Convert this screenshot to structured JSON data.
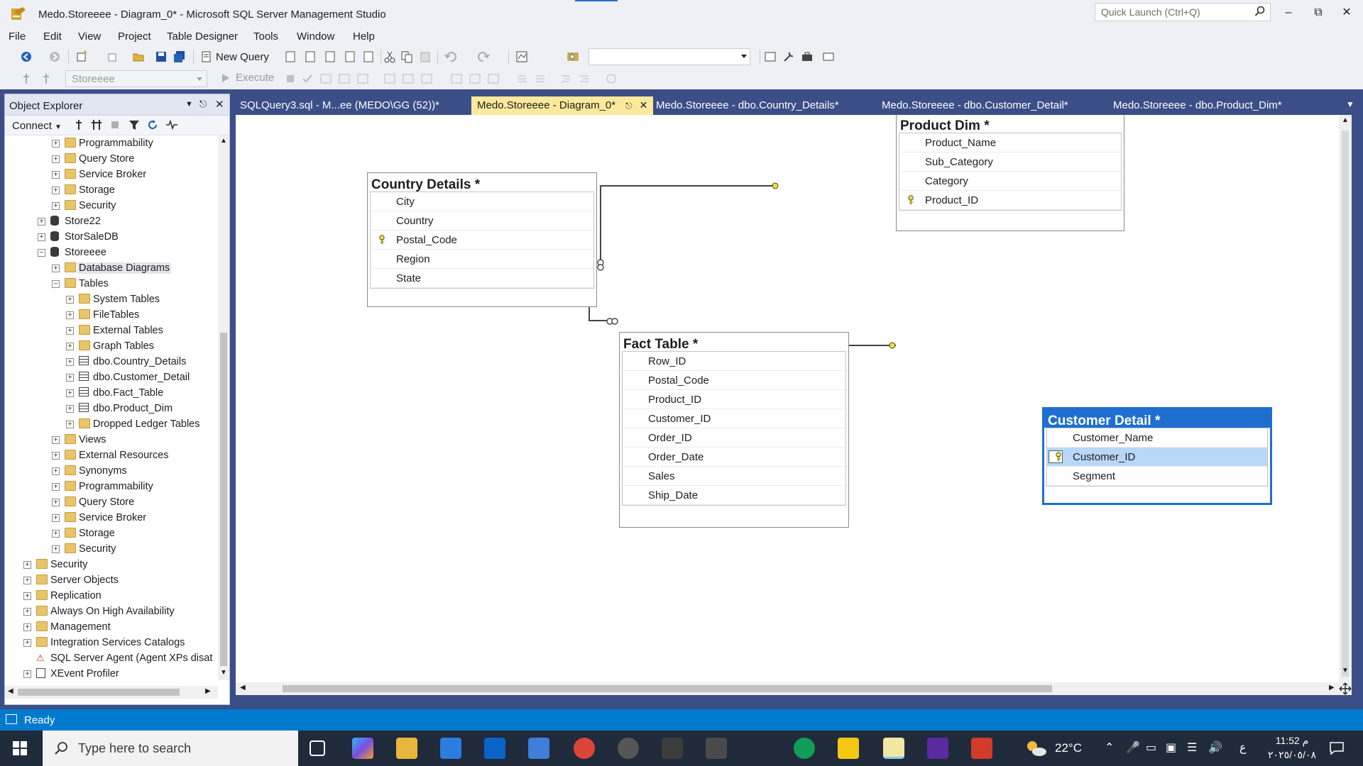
{
  "window": {
    "title": "Medo.Storeeee - Diagram_0* - Microsoft SQL Server Management Studio",
    "quick_launch_placeholder": "Quick Launch (Ctrl+Q)"
  },
  "menu": [
    "File",
    "Edit",
    "View",
    "Project",
    "Table Designer",
    "Tools",
    "Window",
    "Help"
  ],
  "toolbar": {
    "new_query": "New Query",
    "database_combo": "Storeeee",
    "execute": "Execute"
  },
  "object_explorer": {
    "title": "Object Explorer",
    "connect": "Connect",
    "tree": [
      {
        "label": "Programmability",
        "type": "folder",
        "level": 3,
        "expander": "+"
      },
      {
        "label": "Query Store",
        "type": "folder",
        "level": 3,
        "expander": "+"
      },
      {
        "label": "Service Broker",
        "type": "folder",
        "level": 3,
        "expander": "+"
      },
      {
        "label": "Storage",
        "type": "folder",
        "level": 3,
        "expander": "+"
      },
      {
        "label": "Security",
        "type": "folder",
        "level": 3,
        "expander": "+"
      },
      {
        "label": "Store22",
        "type": "db",
        "level": 2,
        "expander": "+"
      },
      {
        "label": "StorSaleDB",
        "type": "db",
        "level": 2,
        "expander": "+"
      },
      {
        "label": "Storeeee",
        "type": "db",
        "level": 2,
        "expander": "-"
      },
      {
        "label": "Database Diagrams",
        "type": "folder",
        "level": 3,
        "expander": "+",
        "selected": true
      },
      {
        "label": "Tables",
        "type": "folder",
        "level": 3,
        "expander": "-"
      },
      {
        "label": "System Tables",
        "type": "folder",
        "level": 4,
        "expander": "+"
      },
      {
        "label": "FileTables",
        "type": "folder",
        "level": 4,
        "expander": "+"
      },
      {
        "label": "External Tables",
        "type": "folder",
        "level": 4,
        "expander": "+"
      },
      {
        "label": "Graph Tables",
        "type": "folder",
        "level": 4,
        "expander": "+"
      },
      {
        "label": "dbo.Country_Details",
        "type": "table",
        "level": 4,
        "expander": "+"
      },
      {
        "label": "dbo.Customer_Detail",
        "type": "table",
        "level": 4,
        "expander": "+"
      },
      {
        "label": "dbo.Fact_Table",
        "type": "table",
        "level": 4,
        "expander": "+"
      },
      {
        "label": "dbo.Product_Dim",
        "type": "table",
        "level": 4,
        "expander": "+"
      },
      {
        "label": "Dropped Ledger Tables",
        "type": "folder",
        "level": 4,
        "expander": "+"
      },
      {
        "label": "Views",
        "type": "folder",
        "level": 3,
        "expander": "+"
      },
      {
        "label": "External Resources",
        "type": "folder",
        "level": 3,
        "expander": "+"
      },
      {
        "label": "Synonyms",
        "type": "folder",
        "level": 3,
        "expander": "+"
      },
      {
        "label": "Programmability",
        "type": "folder",
        "level": 3,
        "expander": "+"
      },
      {
        "label": "Query Store",
        "type": "folder",
        "level": 3,
        "expander": "+"
      },
      {
        "label": "Service Broker",
        "type": "folder",
        "level": 3,
        "expander": "+"
      },
      {
        "label": "Storage",
        "type": "folder",
        "level": 3,
        "expander": "+"
      },
      {
        "label": "Security",
        "type": "folder",
        "level": 3,
        "expander": "+"
      },
      {
        "label": "Security",
        "type": "folder",
        "level": 1,
        "expander": "+"
      },
      {
        "label": "Server Objects",
        "type": "folder",
        "level": 1,
        "expander": "+"
      },
      {
        "label": "Replication",
        "type": "folder",
        "level": 1,
        "expander": "+"
      },
      {
        "label": "Always On High Availability",
        "type": "folder",
        "level": 1,
        "expander": "+"
      },
      {
        "label": "Management",
        "type": "folder",
        "level": 1,
        "expander": "+"
      },
      {
        "label": "Integration Services Catalogs",
        "type": "folder",
        "level": 1,
        "expander": "+"
      },
      {
        "label": "SQL Server Agent (Agent XPs disat",
        "type": "agent",
        "level": 1,
        "expander": ""
      },
      {
        "label": "XEvent Profiler",
        "type": "xevent",
        "level": 1,
        "expander": "+"
      }
    ]
  },
  "tabs": [
    {
      "label": "SQLQuery3.sql - M...ee (MEDO\\GG (52))*",
      "active": false
    },
    {
      "label": "Medo.Storeeee - Diagram_0*",
      "active": true
    },
    {
      "label": "Medo.Storeeee - dbo.Country_Details*",
      "active": false
    },
    {
      "label": "Medo.Storeeee - dbo.Customer_Detail*",
      "active": false
    },
    {
      "label": "Medo.Storeeee - dbo.Product_Dim*",
      "active": false
    }
  ],
  "diagram": {
    "tables": [
      {
        "id": "country",
        "title": "Country Details *",
        "columns": [
          {
            "name": "City",
            "key": false
          },
          {
            "name": "Country",
            "key": false
          },
          {
            "name": "Postal_Code",
            "key": true
          },
          {
            "name": "Region",
            "key": false
          },
          {
            "name": "State",
            "key": false
          }
        ]
      },
      {
        "id": "product",
        "title": "Product Dim *",
        "columns": [
          {
            "name": "Product_Name",
            "key": false
          },
          {
            "name": "Sub_Category",
            "key": false
          },
          {
            "name": "Category",
            "key": false
          },
          {
            "name": "Product_ID",
            "key": true
          }
        ]
      },
      {
        "id": "fact",
        "title": "Fact Table *",
        "columns": [
          {
            "name": "Row_ID",
            "key": false
          },
          {
            "name": "Postal_Code",
            "key": false
          },
          {
            "name": "Product_ID",
            "key": false
          },
          {
            "name": "Customer_ID",
            "key": false
          },
          {
            "name": "Order_ID",
            "key": false
          },
          {
            "name": "Order_Date",
            "key": false
          },
          {
            "name": "Sales",
            "key": false
          },
          {
            "name": "Ship_Date",
            "key": false
          }
        ]
      },
      {
        "id": "customer",
        "title": "Customer Detail *",
        "selected": true,
        "columns": [
          {
            "name": "Customer_Name",
            "key": false
          },
          {
            "name": "Customer_ID",
            "key": true,
            "highlight": true
          },
          {
            "name": "Segment",
            "key": false
          }
        ]
      }
    ]
  },
  "status": {
    "text": "Ready"
  },
  "taskbar": {
    "search_placeholder": "Type here to search",
    "temperature": "22°C",
    "time": "11:52 م",
    "date": "٢٠٢٥/٠٥/٠٨"
  }
}
